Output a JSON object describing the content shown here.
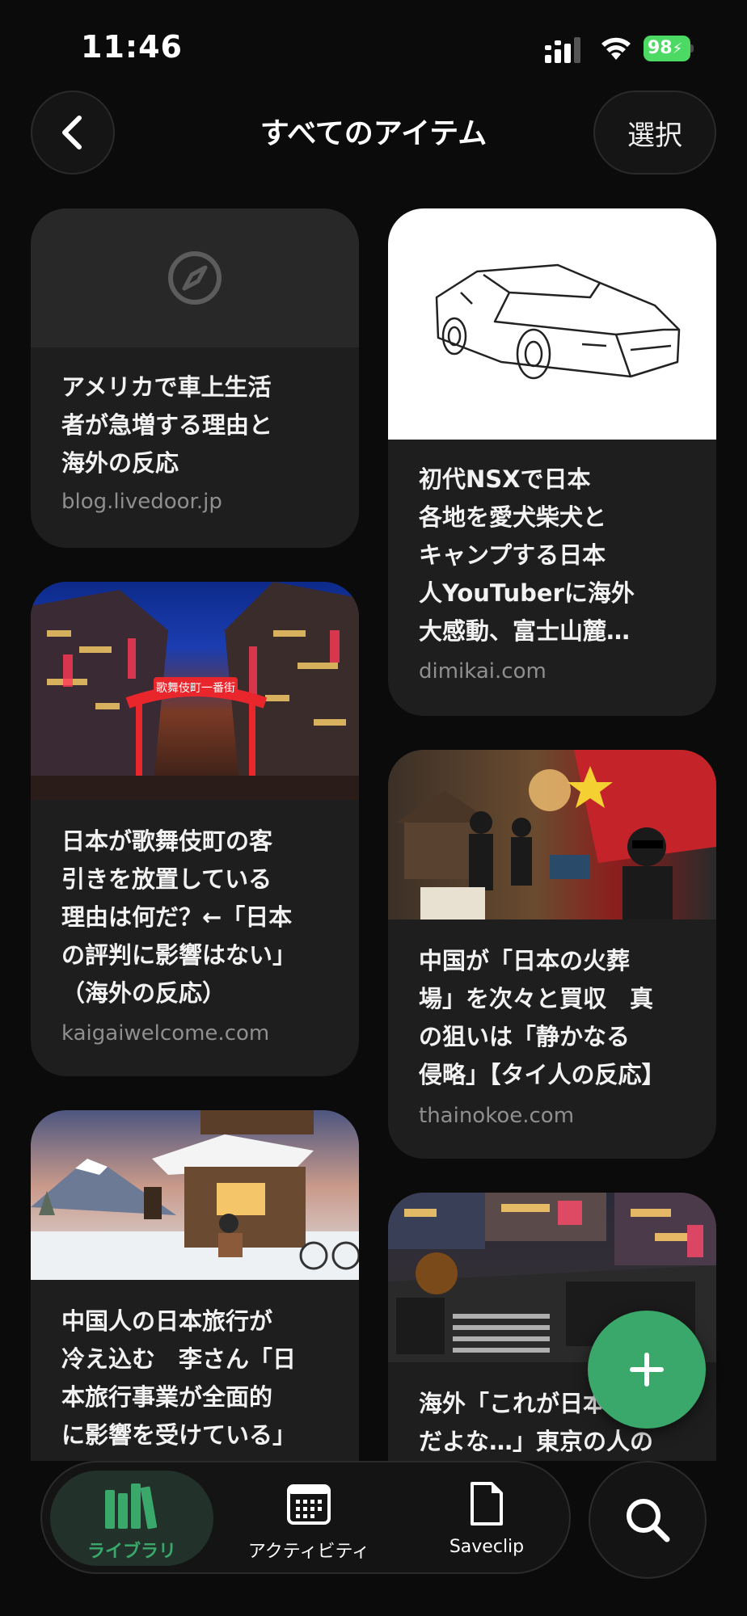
{
  "status_bar": {
    "time": "11:46",
    "battery": "98",
    "icons": [
      "cellular-signal-icon",
      "wifi-icon",
      "battery-charging-icon"
    ]
  },
  "nav": {
    "title": "すべてのアイテム",
    "select_label": "選択",
    "back_icon": "chevron-left-icon"
  },
  "items": [
    {
      "title": "アメリカで車上生活\n者が急増する理由と\n海外の反応",
      "source": "blog.livedoor.jp",
      "thumbnail": "compass-placeholder-icon"
    },
    {
      "title": "初代NSXで日本\n各地を愛犬柴犬と\nキャンプする日本\n人YouTuberに海外\n大感動、富士山麓…",
      "source": "dimikai.com",
      "thumbnail": "sports-car-line-drawing"
    },
    {
      "title": "日本が歌舞伎町の客\n引きを放置している\n理由は何だ？←「日本\nの評判に影響はない」\n（海外の反応）",
      "source": "kaigaiwelcome.com",
      "thumbnail": "kabukicho-night-street",
      "sign_text": "歌舞伎町一番街"
    },
    {
      "title": "中国が「日本の火葬\n場」を次々と買収　真\nの狙いは「静かなる\n侵略」【タイ人の反応】",
      "source": "thainokoe.com",
      "thumbnail": "illustration-business-deal"
    },
    {
      "title": "中国人の日本旅行が\n冷え込む　李さん「日\n本旅行事業が全面的\nに影響を受けている」",
      "source": "",
      "thumbnail": "illustration-mount-fuji-shop"
    },
    {
      "title": "海外「これが日本\nだよな…」東京の人の",
      "source": "",
      "thumbnail": "shibuya-crossing-night"
    }
  ],
  "bottom_nav": {
    "tabs": [
      {
        "label": "ライブラリ",
        "icon": "library-books-icon",
        "active": true
      },
      {
        "label": "アクティビティ",
        "icon": "calendar-icon",
        "active": false
      },
      {
        "label": "Saveclip",
        "icon": "document-icon",
        "active": false
      }
    ],
    "search_icon": "search-icon",
    "add_icon": "plus-icon"
  },
  "colors": {
    "background": "#0b0b0b",
    "card": "#1e1e1e",
    "accent": "#3aa86a",
    "battery": "#4cd964"
  }
}
